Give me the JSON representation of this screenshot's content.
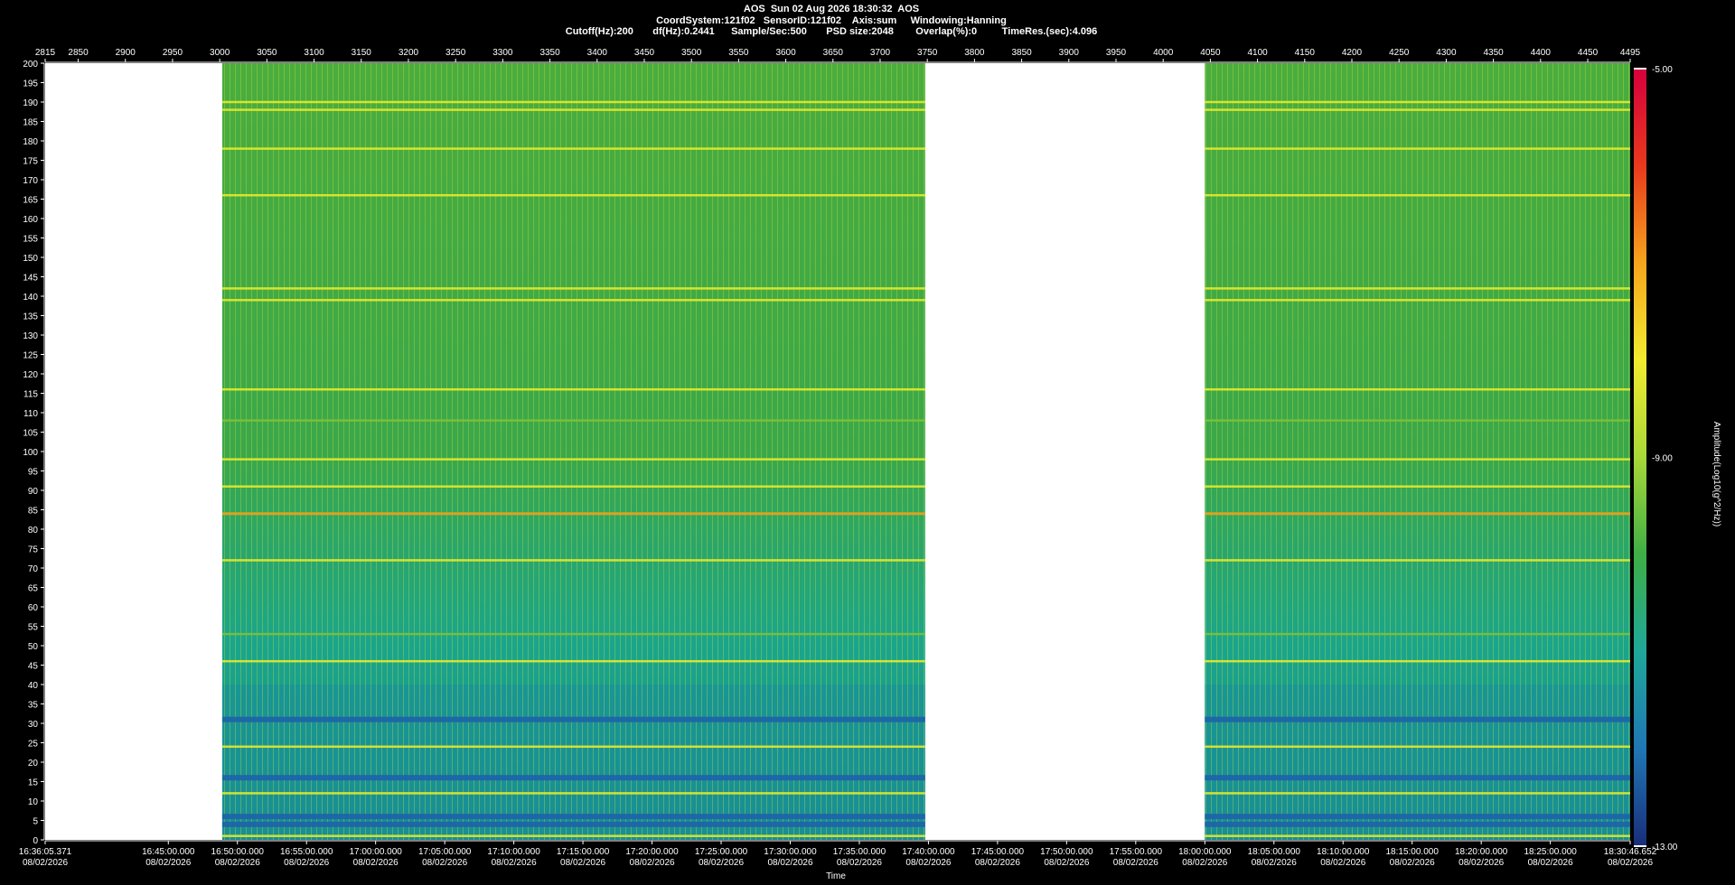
{
  "header": {
    "line1": "AOS  Sun 02 Aug 2026 18:30:32  AOS",
    "line2": "CoordSystem:121f02   SensorID:121f02    Axis:sum     Windowing:Hanning",
    "line3": "Cutoff(Hz):200       df(Hz):0.2441      Sample/Sec:500       PSD size:2048        Overlap(%):0         TimeRes.(sec):4.096"
  },
  "chart_data": {
    "type": "heatmap",
    "title": "AOS  Sun 02 Aug 2026 18:30:32  AOS",
    "xlabel": "Time",
    "ylabel": "",
    "colorbar_label": "Amplitude(Log10(g^2/Hz))",
    "top_axis": {
      "ticks": [
        "2815",
        "2850",
        "2900",
        "2950",
        "3000",
        "3050",
        "3100",
        "3150",
        "3200",
        "3250",
        "3300",
        "3350",
        "3400",
        "3450",
        "3500",
        "3550",
        "3600",
        "3650",
        "3700",
        "3750",
        "3800",
        "3850",
        "3900",
        "3950",
        "4000",
        "4050",
        "4100",
        "4150",
        "4200",
        "4250",
        "4300",
        "4350",
        "4400",
        "4450",
        "4495"
      ],
      "range": [
        2815,
        4495
      ]
    },
    "y_axis": {
      "range": [
        0,
        200
      ],
      "ticks": [
        0,
        5,
        10,
        15,
        20,
        25,
        30,
        35,
        40,
        45,
        50,
        55,
        60,
        65,
        70,
        75,
        80,
        85,
        90,
        95,
        100,
        105,
        110,
        115,
        120,
        125,
        130,
        135,
        140,
        145,
        150,
        155,
        160,
        165,
        170,
        175,
        180,
        185,
        190,
        195,
        200
      ]
    },
    "x_axis": {
      "start": "16:36:05.371",
      "end": "18:30:46.652",
      "ticks": [
        {
          "time": "16:36:05.371",
          "date": "08/02/2026"
        },
        {
          "time": "16:45:00.000",
          "date": "08/02/2026"
        },
        {
          "time": "16:50:00.000",
          "date": "08/02/2026"
        },
        {
          "time": "16:55:00.000",
          "date": "08/02/2026"
        },
        {
          "time": "17:00:00.000",
          "date": "08/02/2026"
        },
        {
          "time": "17:05:00.000",
          "date": "08/02/2026"
        },
        {
          "time": "17:10:00.000",
          "date": "08/02/2026"
        },
        {
          "time": "17:15:00.000",
          "date": "08/02/2026"
        },
        {
          "time": "17:20:00.000",
          "date": "08/02/2026"
        },
        {
          "time": "17:25:00.000",
          "date": "08/02/2026"
        },
        {
          "time": "17:30:00.000",
          "date": "08/02/2026"
        },
        {
          "time": "17:35:00.000",
          "date": "08/02/2026"
        },
        {
          "time": "17:40:00.000",
          "date": "08/02/2026"
        },
        {
          "time": "17:45:00.000",
          "date": "08/02/2026"
        },
        {
          "time": "17:50:00.000",
          "date": "08/02/2026"
        },
        {
          "time": "17:55:00.000",
          "date": "08/02/2026"
        },
        {
          "time": "18:00:00.000",
          "date": "08/02/2026"
        },
        {
          "time": "18:05:00.000",
          "date": "08/02/2026"
        },
        {
          "time": "18:10:00.000",
          "date": "08/02/2026"
        },
        {
          "time": "18:15:00.000",
          "date": "08/02/2026"
        },
        {
          "time": "18:20:00.000",
          "date": "08/02/2026"
        },
        {
          "time": "18:25:00.000",
          "date": "08/02/2026"
        },
        {
          "time": "18:30:46.652",
          "date": "08/02/2026"
        }
      ]
    },
    "colorbar": {
      "min": -13.0,
      "max": -5.0,
      "labels": [
        "-5.00",
        "-9.00",
        "-13.00"
      ],
      "colors": [
        "#1a2d7a",
        "#1f77b4",
        "#1fa89a",
        "#3fae46",
        "#a8d838",
        "#f2ec2e",
        "#f7a51c",
        "#e8391d",
        "#d6003c"
      ]
    },
    "data_segments": [
      {
        "start": "16:48:54",
        "end": "17:39:46"
      },
      {
        "start": "18:00:00",
        "end": "18:30:46.652"
      }
    ],
    "bands": [
      {
        "freq": 1,
        "level": "yellow"
      },
      {
        "freq": 4,
        "level": "blue"
      },
      {
        "freq": 6,
        "level": "blue"
      },
      {
        "freq": 12,
        "level": "yellow"
      },
      {
        "freq": 16,
        "level": "blue"
      },
      {
        "freq": 24,
        "level": "yellow"
      },
      {
        "freq": 31,
        "level": "blue"
      },
      {
        "freq": 46,
        "level": "yellow"
      },
      {
        "freq": 53,
        "level": "green"
      },
      {
        "freq": 72,
        "level": "yellow"
      },
      {
        "freq": 84,
        "level": "orange"
      },
      {
        "freq": 91,
        "level": "yellow"
      },
      {
        "freq": 98,
        "level": "yellow"
      },
      {
        "freq": 108,
        "level": "green"
      },
      {
        "freq": 116,
        "level": "yellow"
      },
      {
        "freq": 139,
        "level": "yellow"
      },
      {
        "freq": 142,
        "level": "yellow"
      },
      {
        "freq": 166,
        "level": "yellow"
      },
      {
        "freq": 178,
        "level": "yellow"
      },
      {
        "freq": 188,
        "level": "yellow"
      },
      {
        "freq": 190,
        "level": "yellow"
      }
    ]
  }
}
